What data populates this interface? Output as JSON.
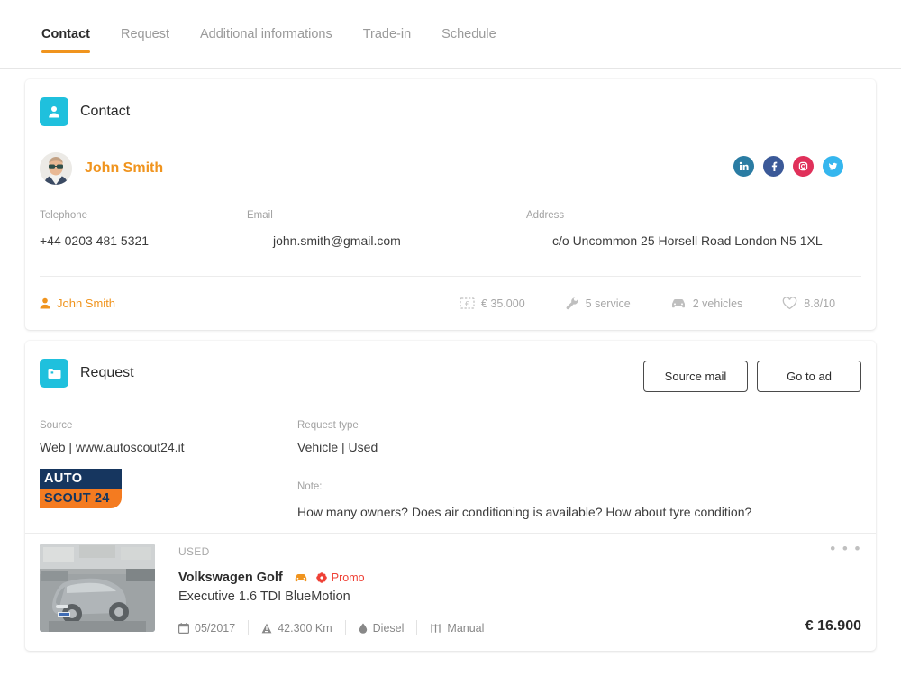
{
  "tabs": [
    {
      "label": "Contact",
      "active": true
    },
    {
      "label": "Request",
      "active": false
    },
    {
      "label": "Additional informations",
      "active": false
    },
    {
      "label": "Trade-in",
      "active": false
    },
    {
      "label": "Schedule",
      "active": false
    }
  ],
  "contact": {
    "section_title": "Contact",
    "section_icon": "person-icon",
    "person_name": "John Smith",
    "avatar_icon": "avatar-photo",
    "socials": [
      {
        "name": "linkedin-icon",
        "label": "in",
        "color": "#2a7ca3"
      },
      {
        "name": "facebook-icon",
        "label": "f",
        "color": "#3b5998"
      },
      {
        "name": "instagram-icon",
        "label": "",
        "color": "#e0305a"
      },
      {
        "name": "twitter-icon",
        "label": "",
        "color": "#35b6ee"
      }
    ],
    "fields": [
      {
        "label": "Telephone",
        "value": "+44 0203 481 5321"
      },
      {
        "label": "Email",
        "value": "john.smith@gmail.com"
      },
      {
        "label": "Address",
        "value": "c/o Uncommon 25 Horsell Road London N5 1XL"
      }
    ],
    "owner_link": "John Smith",
    "owner_icon": "user-icon",
    "stats": [
      {
        "icon": "money-icon",
        "value": "€ 35.000"
      },
      {
        "icon": "wrench-icon",
        "value": "5 service"
      },
      {
        "icon": "car-icon",
        "value": "2 vehicles"
      },
      {
        "icon": "heart-icon",
        "value": "8.8/10"
      }
    ]
  },
  "request": {
    "section_title": "Request",
    "section_icon": "folder-icon",
    "buttons": [
      {
        "name": "source-mail-button",
        "label": "Source mail"
      },
      {
        "name": "go-to-ad-button",
        "label": "Go to ad"
      }
    ],
    "source_label": "Source",
    "source_value": "Web | www.autoscout24.it",
    "source_logo": {
      "top": "AUTO",
      "bottom": "SCOUT 24"
    },
    "type_label": "Request type",
    "type_value": "Vehicle | Used",
    "note_label": "Note:",
    "note_text": "How many owners? Does air conditioning is available? How about tyre condition?"
  },
  "vehicle": {
    "condition": "USED",
    "title": "Volkswagen Golf",
    "subtitle": "Executive 1.6 TDI BlueMotion",
    "badge_car_icon": "car-icon",
    "promo_label": "Promo",
    "promo_icon": "promo-flower-icon",
    "thumb_icon": "vehicle-photo",
    "specs": [
      {
        "icon": "calendar-icon",
        "value": "05/2017"
      },
      {
        "icon": "mileage-icon",
        "value": "42.300 Km"
      },
      {
        "icon": "fuel-icon",
        "value": "Diesel"
      },
      {
        "icon": "gearbox-icon",
        "value": "Manual"
      }
    ],
    "price": "€ 16.900",
    "menu_icon": "more-options-icon",
    "menu_label": "• • •"
  },
  "colors": {
    "accent_orange": "#f0941e",
    "section_cyan": "#1fc0dd",
    "promo_red": "#ef4136"
  }
}
